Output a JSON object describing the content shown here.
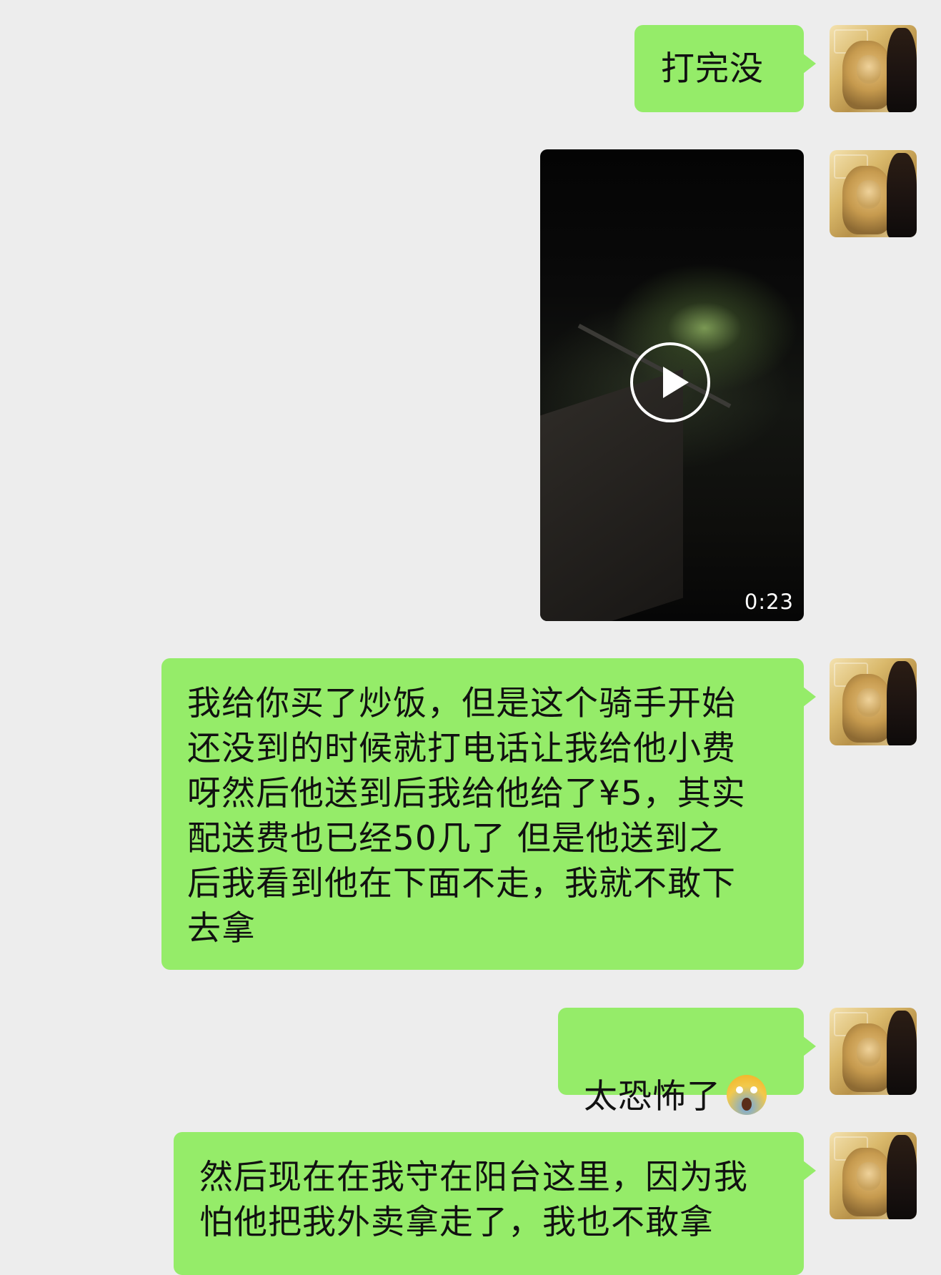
{
  "messages": [
    {
      "type": "text",
      "text": "打完没"
    },
    {
      "type": "video",
      "duration": "0:23"
    },
    {
      "type": "text",
      "text": "我给你买了炒饭，但是这个骑手开始\n还没到的时候就打电话让我给他小费\n呀然后他送到后我给他给了¥5，其实\n配送费也已经50几了 但是他送到之\n后我看到他在下面不走，我就不敢下\n去拿"
    },
    {
      "type": "text",
      "text": "太恐怖了",
      "emoji": "scream-emoji"
    },
    {
      "type": "text",
      "text": "然后现在在我守在阳台这里，因为我\n怕他把我外卖拿走了，我也不敢拿"
    }
  ],
  "colors": {
    "bubble": "#95ec69",
    "background": "#ededed"
  }
}
